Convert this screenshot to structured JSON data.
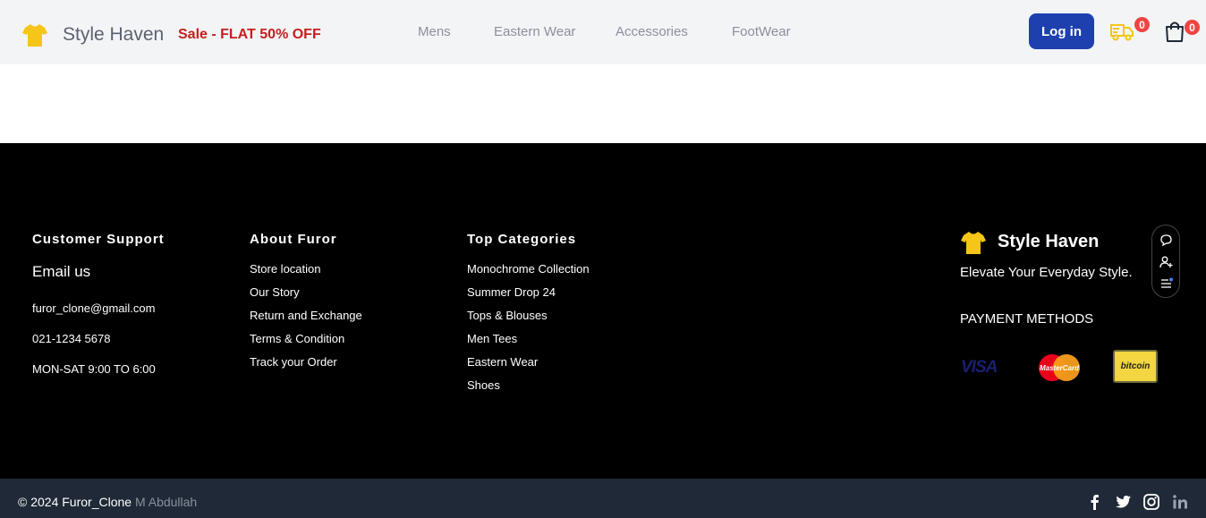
{
  "header": {
    "brand": "Style Haven",
    "sale": "Sale - FLAT 50% OFF",
    "nav": [
      "Mens",
      "Eastern Wear",
      "Accessories",
      "FootWear"
    ],
    "login": "Log in",
    "truck_count": "0",
    "cart_count": "0"
  },
  "footer": {
    "support": {
      "title": "Customer Support",
      "email_heading": "Email us",
      "email": "furor_clone@gmail.com",
      "phone": "021-1234 5678",
      "hours": "MON-SAT 9:00 TO 6:00"
    },
    "about": {
      "title": "About Furor",
      "links": [
        "Store location",
        "Our Story",
        "Return and Exchange",
        "Terms & Condition",
        "Track your Order"
      ]
    },
    "categories": {
      "title": "Top Categories",
      "links": [
        "Monochrome Collection",
        "Summer Drop 24",
        "Tops & Blouses",
        "Men Tees",
        "Eastern Wear",
        "Shoes"
      ]
    },
    "brand": "Style Haven",
    "tagline": "Elevate Your Everyday Style.",
    "payment_title": "PAYMENT METHODS",
    "payment": {
      "visa": "VISA",
      "mastercard": "MasterCard",
      "bitcoin": "bitcoin"
    }
  },
  "bottom": {
    "copyright": "© 2024 Furor_Clone",
    "author": "M Abdullah"
  },
  "icons": [
    "tshirt-icon",
    "truck-icon",
    "cart-icon",
    "chat-icon",
    "add-user-icon",
    "list-icon",
    "facebook-icon",
    "twitter-icon",
    "instagram-icon",
    "linkedin-icon"
  ],
  "colors": {
    "accent": "#1e40af",
    "sale": "#c81e1e",
    "badge": "#ef4444",
    "logo": "#f5c518",
    "footer_bg": "#000000",
    "bottom_bg": "#1f2937"
  }
}
